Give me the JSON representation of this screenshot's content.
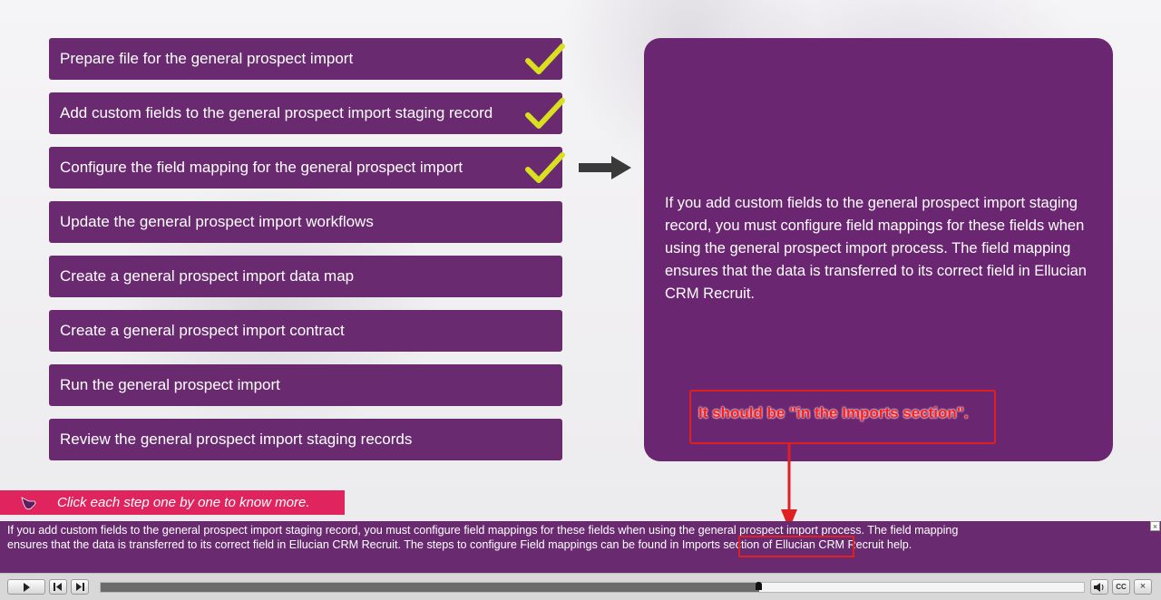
{
  "steps": [
    {
      "label": "Prepare file for the general prospect import",
      "completed": true
    },
    {
      "label": "Add custom fields to the general prospect import staging record",
      "completed": true
    },
    {
      "label": "Configure the field mapping for the general prospect import",
      "completed": true
    },
    {
      "label": "Update the general prospect import workflows",
      "completed": false
    },
    {
      "label": "Create a general prospect import data map",
      "completed": false
    },
    {
      "label": "Create a general prospect import contract",
      "completed": false
    },
    {
      "label": "Run the general prospect import",
      "completed": false
    },
    {
      "label": "Review the general prospect import staging records",
      "completed": false
    }
  ],
  "panel": {
    "text": "If you add custom fields to the general prospect import staging record, you must configure field mappings for these fields when using the general prospect import process. The field mapping ensures that the data is transferred to its correct field in Ellucian CRM Recruit."
  },
  "review_note": {
    "text": "It should be \"in the Imports section\"."
  },
  "hint": {
    "text": "Click each step one by one to know more.",
    "icon": "pointer-hand-icon"
  },
  "caption": {
    "line1": "If you add custom fields to the general prospect import staging record, you must configure field mappings for these fields when using the general prospect import process. The field mapping",
    "line2": "ensures that the data is transferred to its correct field in Ellucian CRM Recruit. The steps to configure Field mappings can be found in Imports section of Ellucian CRM Recruit help."
  },
  "player": {
    "progress_fraction": 0.67,
    "buttons": [
      "play",
      "rewind",
      "forward",
      "volume",
      "closed-captions",
      "close"
    ]
  },
  "colors": {
    "step_bg": "#6a2a70",
    "panel_bg": "#6a2670",
    "check": "#d8e020",
    "hint_bg": "#e0245e",
    "annotation": "#e02020"
  }
}
